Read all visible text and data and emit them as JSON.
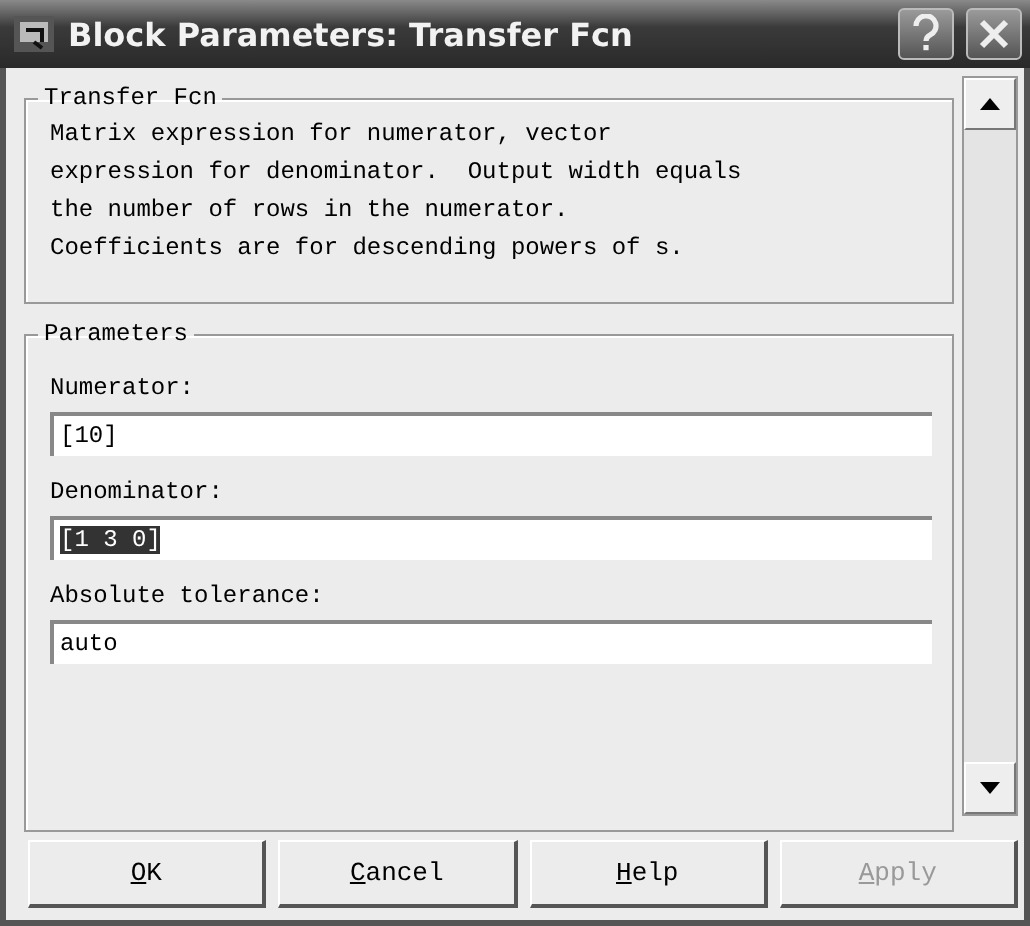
{
  "window": {
    "title": "Block Parameters: Transfer Fcn"
  },
  "description_group": {
    "title": "Transfer Fcn",
    "text": "Matrix expression for numerator, vector\nexpression for denominator.  Output width equals\nthe number of rows in the numerator.\nCoefficients are for descending powers of s."
  },
  "parameters_group": {
    "title": "Parameters",
    "fields": [
      {
        "label": "Numerator:",
        "value": "[10]",
        "selected": false
      },
      {
        "label": "Denominator:",
        "value": "[1 3 0]",
        "selected": true
      },
      {
        "label": "Absolute tolerance:",
        "value": "auto",
        "selected": false
      }
    ]
  },
  "buttons": [
    {
      "label": "OK",
      "disabled": false
    },
    {
      "label": "Cancel",
      "disabled": false
    },
    {
      "label": "Help",
      "disabled": false
    },
    {
      "label": "Apply",
      "disabled": true
    }
  ]
}
